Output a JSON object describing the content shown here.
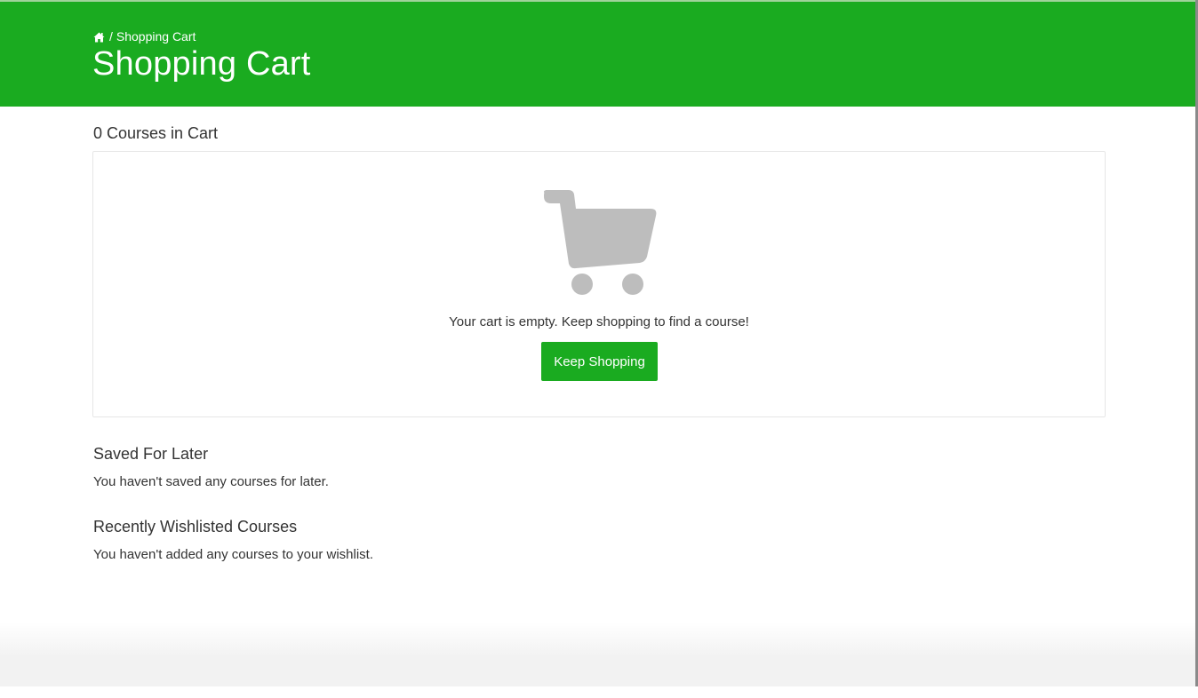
{
  "header": {
    "breadcrumb": {
      "home_icon": "home-icon",
      "separator": "/",
      "current": "Shopping Cart"
    },
    "title": "Shopping Cart"
  },
  "cart": {
    "count_title": "0 Courses in Cart",
    "empty_icon": "shopping-cart-icon",
    "empty_message": "Your cart is empty. Keep shopping to find a course!",
    "keep_shopping_label": "Keep Shopping"
  },
  "saved_for_later": {
    "title": "Saved For Later",
    "message": "You haven't saved any courses for later."
  },
  "wishlist": {
    "title": "Recently Wishlisted Courses",
    "message": "You haven't added any courses to your wishlist."
  },
  "colors": {
    "brand_green": "#1aab20",
    "icon_gray": "#bdbdbd",
    "text": "#333333"
  }
}
